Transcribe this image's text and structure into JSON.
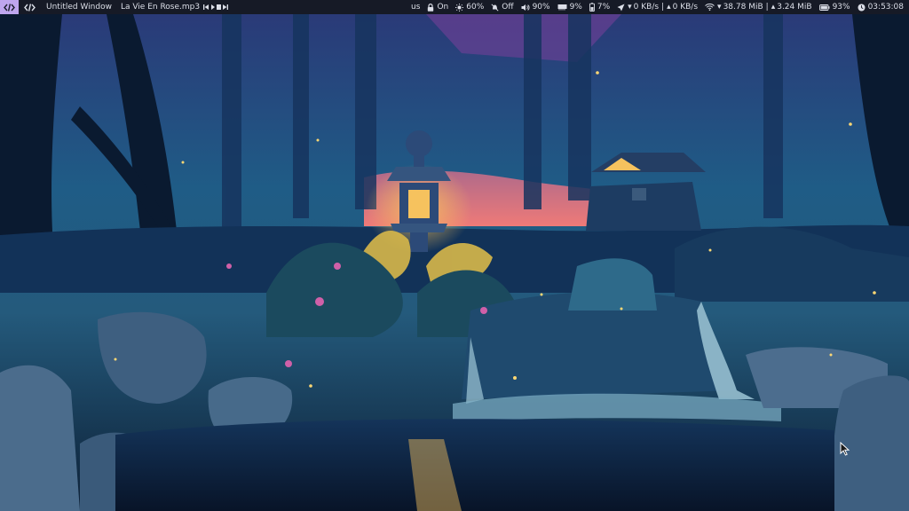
{
  "bar": {
    "window_title": "Untitled Window",
    "media_title": "La Vie En Rose.mp3",
    "keyboard_layout": "us",
    "caps_lock": "On",
    "brightness": "60%",
    "dnd": "Off",
    "volume": "90%",
    "memory": "9%",
    "cpu": "7%",
    "net_down": "0 KB/s",
    "net_up": "0 KB/s",
    "wifi_down": "38.78 MiB",
    "wifi_up": "3.24 MiB",
    "battery": "93%",
    "clock": "03:53:08"
  },
  "colors": {
    "bar_bg": "#161a26",
    "bar_fg": "#dcdfe8",
    "workspace_accent": "#bfa6ee",
    "sky": "#ee7a78",
    "lantern_glow": "#f6c25e"
  },
  "icons": {
    "workspace": "code-icon",
    "media_controls": [
      "previous-icon",
      "play-icon",
      "stop-icon",
      "next-icon"
    ],
    "status": [
      "lock-icon",
      "brightness-icon",
      "dnd-icon",
      "volume-icon",
      "memory-icon",
      "cpu-icon",
      "network-icon",
      "wifi-icon",
      "battery-icon",
      "clock-icon"
    ]
  }
}
